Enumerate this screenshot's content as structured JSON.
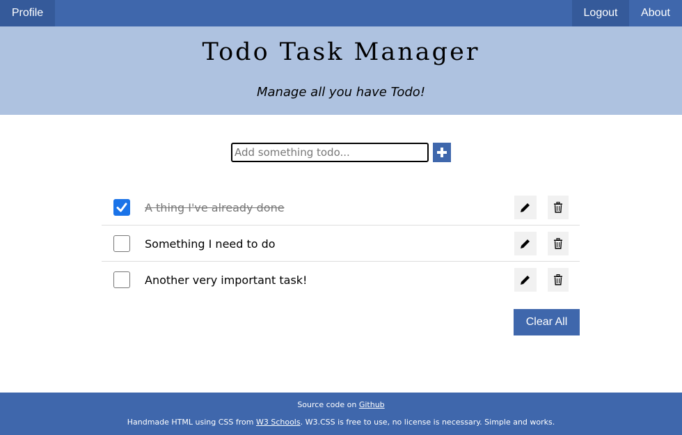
{
  "nav": {
    "profile_label": "Profile",
    "logout_label": "Logout",
    "about_label": "About"
  },
  "header": {
    "title": "Todo Task Manager",
    "subtitle": "Manage all you have Todo!"
  },
  "add_task": {
    "placeholder": "Add something todo...",
    "value": "",
    "button_icon": "plus-icon"
  },
  "tasks": [
    {
      "text": "A thing I've already done",
      "done": true
    },
    {
      "text": "Something I need to do",
      "done": false
    },
    {
      "text": "Another very important task!",
      "done": false
    }
  ],
  "clear_all_label": "Clear All",
  "footer": {
    "source_prefix": "Source code on ",
    "source_link": "Github",
    "credit_prefix": "Handmade HTML using CSS from ",
    "credit_link": "W3 Schools",
    "credit_suffix": ". W3.CSS is free to use, no license is necessary. Simple and works."
  },
  "colors": {
    "nav_bg": "#3f67ac",
    "hero_bg": "#aec2e0",
    "checkbox_checked": "#1a73e8"
  }
}
